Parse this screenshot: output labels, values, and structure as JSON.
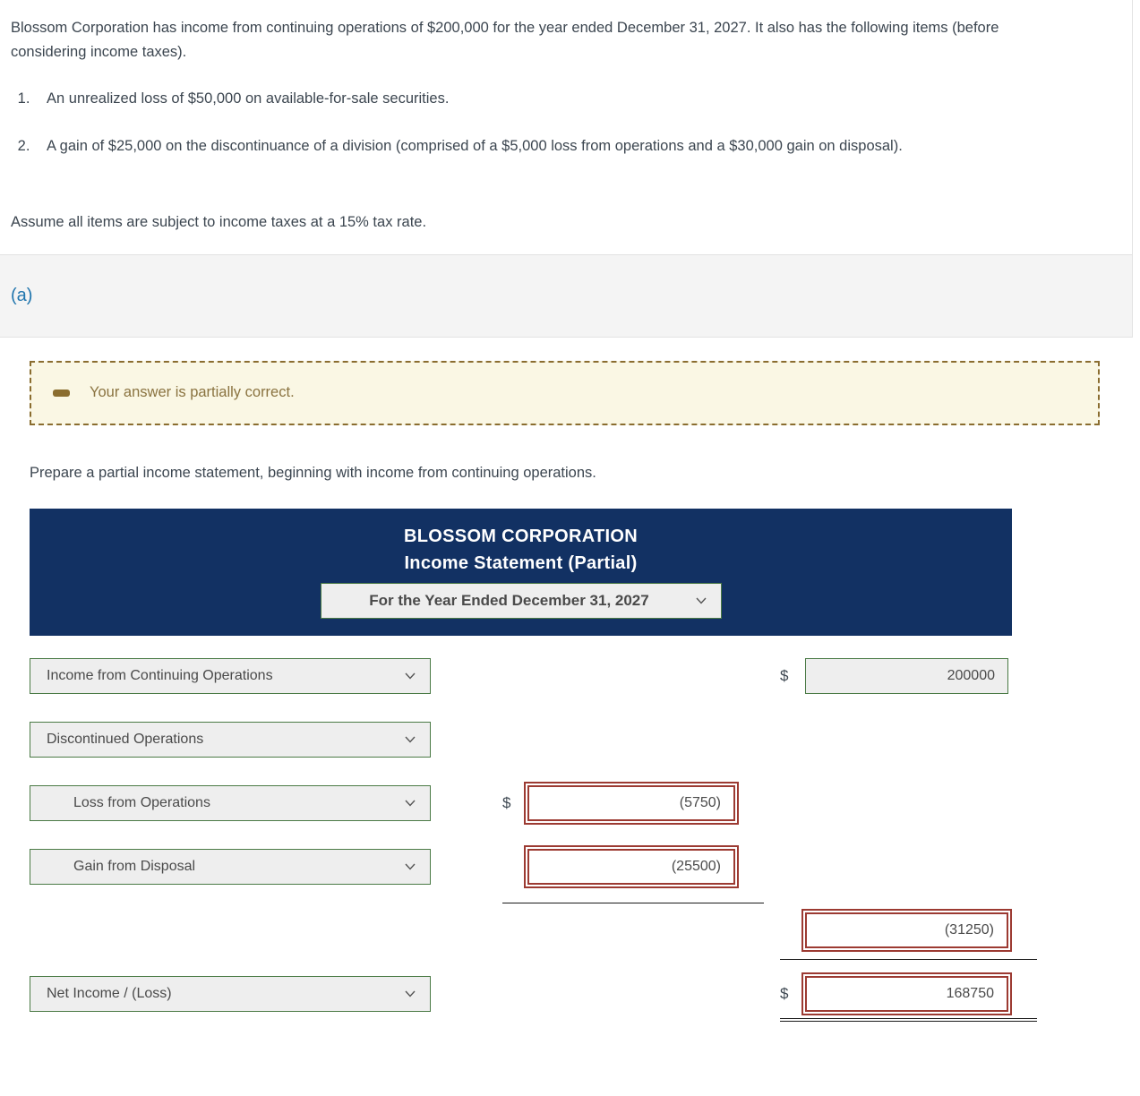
{
  "problem": {
    "intro": "Blossom Corporation has income from continuing operations of $200,000 for the year ended December 31, 2027. It also has the following items (before considering income taxes).",
    "items": [
      "An unrealized loss of $50,000 on available-for-sale securities.",
      "A gain of $25,000 on the discontinuance of a division (comprised of a $5,000 loss from operations and a $30,000 gain on disposal)."
    ],
    "assumption": "Assume all items are subject to income taxes at a 15% tax rate."
  },
  "part": {
    "label": "(a)"
  },
  "alert": {
    "icon": "minus-icon",
    "message": "Your answer is partially correct.",
    "background": "#faf7e4",
    "border_color": "#8a6d2f",
    "text_color": "#8a7340"
  },
  "instruction": "Prepare a partial income statement, beginning with income from continuing operations.",
  "statement": {
    "company": "BLOSSOM CORPORATION",
    "title": "Income Statement (Partial)",
    "period_selected": "For the Year Ended December 31, 2027",
    "header_color": "#123163",
    "ok_border_color": "#4a7a45",
    "error_border_color": "#9c3a32",
    "rows": [
      {
        "account": "Income from Continuing Operations",
        "mid_dollar": "",
        "mid_amount": "",
        "right_dollar": "$",
        "right_amount": "200000",
        "right_state": "ok"
      },
      {
        "account": "Discontinued Operations",
        "mid_dollar": "",
        "mid_amount": "",
        "right_dollar": "",
        "right_amount": "",
        "right_state": ""
      },
      {
        "account": "Loss from Operations",
        "mid_dollar": "$",
        "mid_amount": "(5750)",
        "mid_state": "err",
        "right_dollar": "",
        "right_amount": "",
        "right_state": ""
      },
      {
        "account": "Gain from Disposal",
        "mid_dollar": "",
        "mid_amount": "(25500)",
        "mid_state": "err",
        "right_dollar": "",
        "right_amount": "",
        "right_state": ""
      },
      {
        "account": "",
        "mid_dollar": "",
        "mid_amount": "",
        "right_dollar": "",
        "right_amount": "(31250)",
        "right_state": "err"
      },
      {
        "account": "Net Income / (Loss)",
        "mid_dollar": "",
        "mid_amount": "",
        "right_dollar": "$",
        "right_amount": "168750",
        "right_state": "err"
      }
    ]
  }
}
